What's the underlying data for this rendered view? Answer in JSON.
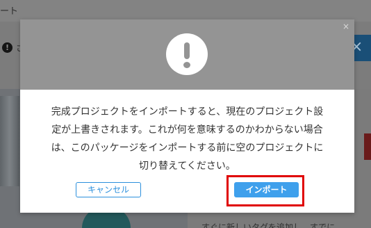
{
  "background": {
    "topbar_title": "ート",
    "notice_icon": "!",
    "notice_text": "さ",
    "close_glyph": "×",
    "bottom_text": "すぐに新しいタグを追加し、すでに"
  },
  "modal": {
    "close_glyph": "×",
    "icon": "exclamation-alert-icon",
    "message_lines": [
      "完成プロジェクトをインポートすると、現在のプロジェクト設",
      "定が上書きされます。これが何を意味するのかわからない場合",
      "は、このパッケージをインポートする前に空のプロジェクトに",
      "切り替えてください。"
    ],
    "cancel_label": "キャンセル",
    "import_label": "インポート"
  },
  "colors": {
    "overlay": "#7c7c7c",
    "modal_header": "#949494",
    "primary": "#3fa0ec",
    "highlight": "#e00000"
  }
}
